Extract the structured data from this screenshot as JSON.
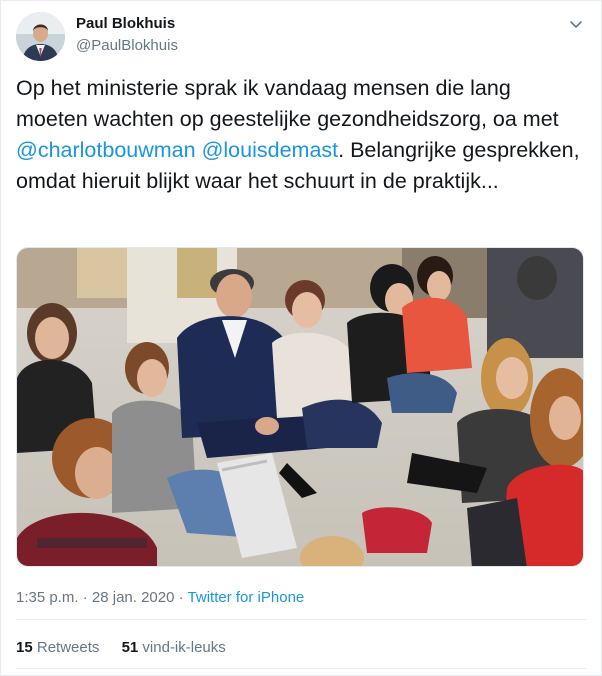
{
  "author": {
    "name": "Paul Blokhuis",
    "handle": "@PaulBlokhuis"
  },
  "tweet": {
    "text_part1": "Op het ministerie sprak ik vandaag mensen die lang moeten wachten op geestelijke gezondheidszorg, oa met ",
    "mention1": "@charlotbouwman",
    "space": " ",
    "mention2": "@louisdemast",
    "text_part2": ". Belangrijke gesprekken, omdat hieruit blijkt waar het schuurt in de praktijk..."
  },
  "meta": {
    "time": "1:35 p.m.",
    "separator1": " · ",
    "date": "28 jan. 2020",
    "separator2": " · ",
    "source": "Twitter for iPhone"
  },
  "stats": {
    "retweets_count": "15",
    "retweets_label": "Retweets",
    "likes_count": "51",
    "likes_label": "vind-ik-leuks"
  },
  "icons": {
    "caret": "chevron-down-icon"
  },
  "colors": {
    "link": "#1b95e0",
    "secondary_text": "#657786",
    "primary_text": "#14171a"
  }
}
